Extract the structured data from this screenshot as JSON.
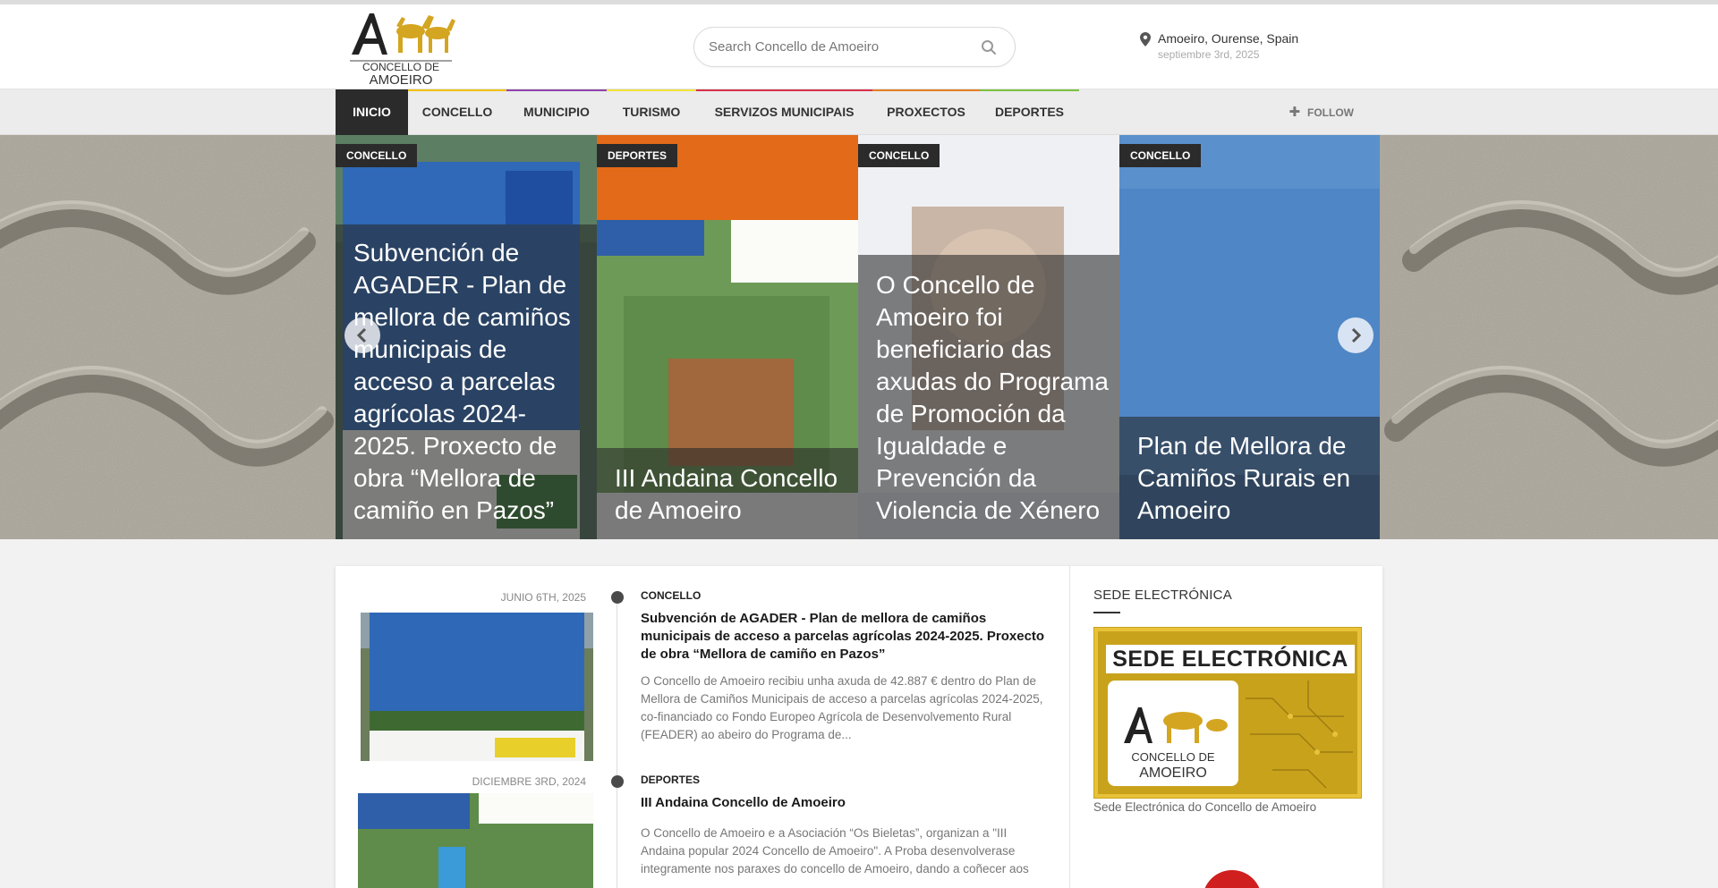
{
  "header": {
    "logo_text": "CONCELLO DE AMOEIRO",
    "search_placeholder": "Search Concello de Amoeiro",
    "location": "Amoeiro, Ourense, Spain",
    "date": "septiembre 3rd, 2025"
  },
  "nav": {
    "items": [
      {
        "label": "INICIO",
        "color": "#2b2b2b"
      },
      {
        "label": "CONCELLO",
        "color": "#f2c200"
      },
      {
        "label": "MUNICIPIO",
        "color": "#8e44ad"
      },
      {
        "label": "TURISMO",
        "color": "#f1e338"
      },
      {
        "label": "SERVIZOS MUNICIPAIS",
        "color": "#d9304a"
      },
      {
        "label": "PROXECTOS",
        "color": "#e67e22"
      },
      {
        "label": "DEPORTES",
        "color": "#7dc242"
      }
    ],
    "follow": "FOLLOW"
  },
  "slider": {
    "slides": [
      {
        "category": "CONCELLO",
        "title": "Subvención de AGADER - Plan de mellora de camiños municipais de acceso a parcelas agrícolas 2024-2025. Proxecto de obra “Mellora de camiño en Pazos”"
      },
      {
        "category": "DEPORTES",
        "title": "III Andaina Concello de Amoeiro"
      },
      {
        "category": "CONCELLO",
        "title": "O Concello de Amoeiro foi beneficiario das axudas do Programa de Promoción da Igualdade e Prevención da Violencia de Xénero"
      },
      {
        "category": "CONCELLO",
        "title": "Plan de Mellora de Camiños Rurais en Amoeiro"
      }
    ]
  },
  "posts": [
    {
      "date": "JUNIO 6TH, 2025",
      "category": "CONCELLO",
      "title": "Subvención de AGADER - Plan de mellora de camiños municipais de acceso a parcelas agrícolas 2024-2025. Proxecto de obra “Mellora de camiño en Pazos”",
      "excerpt": "O Concello de Amoeiro recibiu unha axuda de 42.887 € dentro do Plan de Mellora de Camiños Municipais de acceso a parcelas agrícolas 2024-2025, co-financiado co Fondo Europeo Agrícola de Desenvolvemento Rural (FEADER) ao abeiro do Programa de..."
    },
    {
      "date": "DICIEMBRE 3RD, 2024",
      "category": "DEPORTES",
      "title": "III Andaina Concello de Amoeiro",
      "excerpt": "O Concello de Amoeiro e a Asociación “Os Bieletas”, organizan a \"III Andaina popular 2024 Concello de Amoeiro\". A Proba desenvolverase integramente nos paraxes do concello de Amoeiro, dando a coñecer aos"
    }
  ],
  "sidebar": {
    "title": "SEDE ELECTRÓNICA",
    "banner_text": "SEDE ELECTRÓNICA",
    "caption": "Sede Electrónica do Concello de Amoeiro"
  }
}
